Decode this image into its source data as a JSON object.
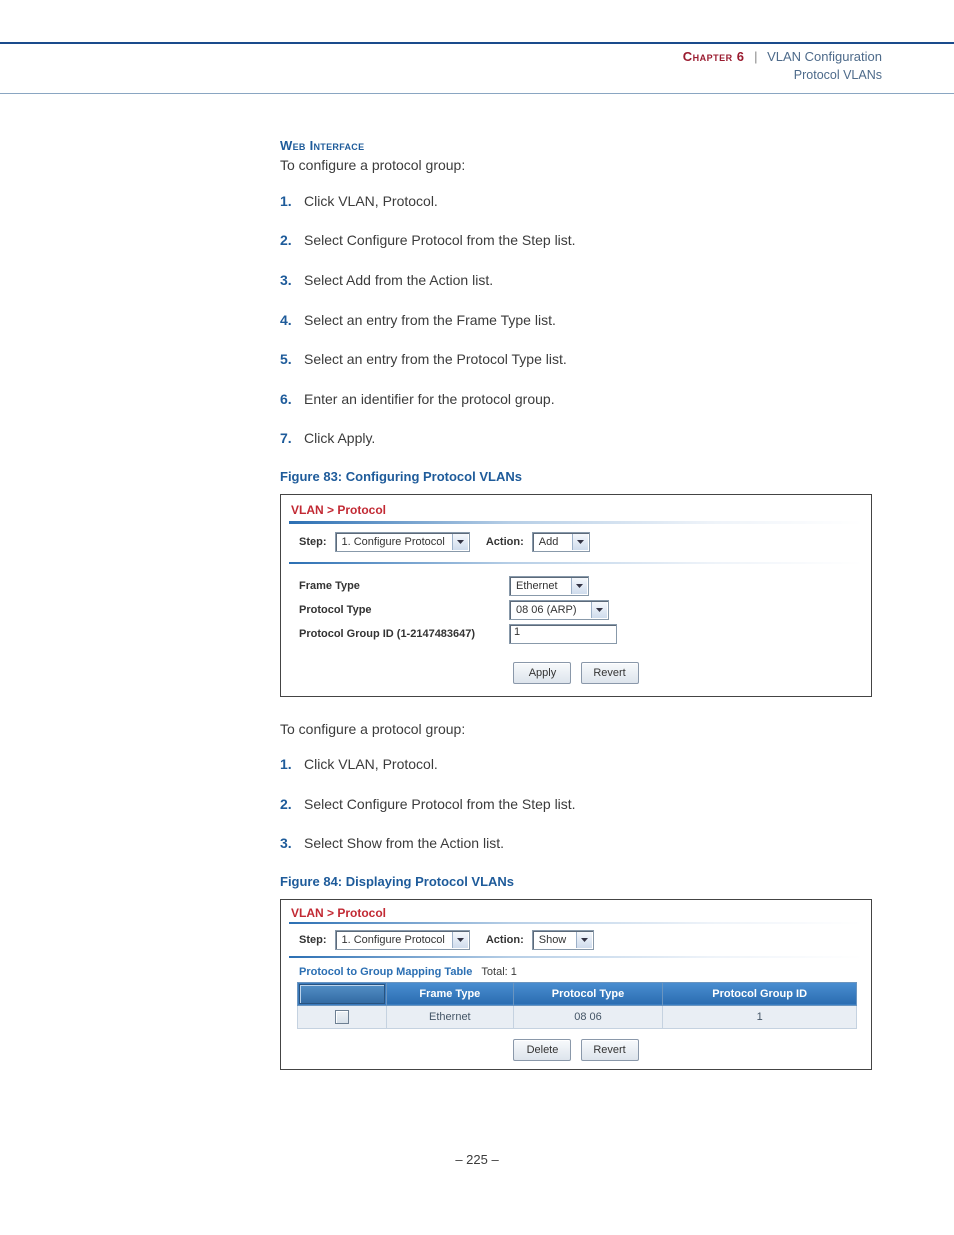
{
  "header": {
    "chapter": "Chapter 6",
    "sep": "|",
    "title": "VLAN Configuration",
    "subtitle": "Protocol VLANs"
  },
  "web_interface": {
    "heading": "Web Interface",
    "intro1": "To configure a protocol group:",
    "steps1": [
      "Click VLAN, Protocol.",
      "Select Configure Protocol from the Step list.",
      "Select Add from the Action list.",
      "Select an entry from the Frame Type list.",
      "Select an entry from the Protocol Type list.",
      "Enter an identifier for the protocol group.",
      "Click Apply."
    ],
    "intro2": "To configure a protocol group:",
    "steps2": [
      "Click VLAN, Protocol.",
      "Select Configure Protocol from the Step list.",
      "Select Show from the Action list."
    ]
  },
  "figure83": {
    "caption": "Figure 83:  Configuring Protocol VLANs",
    "breadcrumb": "VLAN > Protocol",
    "step_label": "Step:",
    "step_value": "1. Configure Protocol",
    "action_label": "Action:",
    "action_value": "Add",
    "frame_type_label": "Frame Type",
    "frame_type_value": "Ethernet",
    "protocol_type_label": "Protocol Type",
    "protocol_type_value": "08 06 (ARP)",
    "group_id_label": "Protocol Group ID (1-2147483647)",
    "group_id_value": "1",
    "apply": "Apply",
    "revert": "Revert"
  },
  "figure84": {
    "caption": "Figure 84:  Displaying Protocol VLANs",
    "breadcrumb": "VLAN > Protocol",
    "step_label": "Step:",
    "step_value": "1. Configure Protocol",
    "action_label": "Action:",
    "action_value": "Show",
    "table_title": "Protocol to Group Mapping Table",
    "table_total_label": "Total:",
    "table_total_value": "1",
    "columns": {
      "c1": "Frame Type",
      "c2": "Protocol Type",
      "c3": "Protocol Group ID"
    },
    "row1": {
      "frame": "Ethernet",
      "proto": "08 06",
      "gid": "1"
    },
    "delete": "Delete",
    "revert": "Revert"
  },
  "footer": {
    "page": "–  225  –"
  }
}
